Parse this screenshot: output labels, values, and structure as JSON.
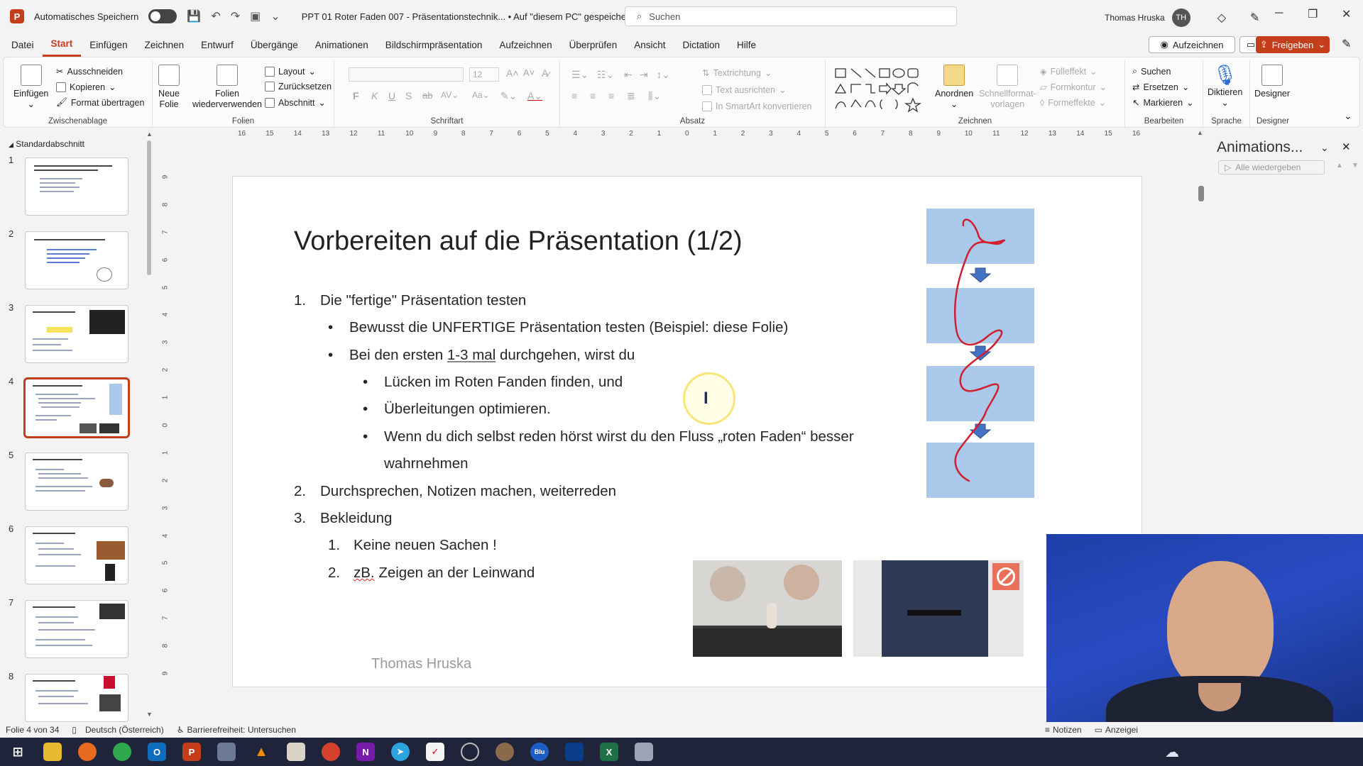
{
  "window": {
    "autosave_label": "Automatisches Speichern",
    "doc_title": "PPT 01 Roter Faden 007 - Präsentationstechnik...  •  Auf \"diesem PC\" gespeichert",
    "search_placeholder": "Suchen",
    "user_name": "Thomas Hruska",
    "user_initials": "TH"
  },
  "menu": {
    "tabs": [
      "Datei",
      "Start",
      "Einfügen",
      "Zeichnen",
      "Entwurf",
      "Übergänge",
      "Animationen",
      "Bildschirmpräsentation",
      "Aufzeichnen",
      "Überprüfen",
      "Ansicht",
      "Dictation",
      "Hilfe"
    ],
    "active": "Start",
    "record_label": "Aufzeichnen",
    "share_label": "Freigeben"
  },
  "ribbon": {
    "clipboard": {
      "paste": "Einfügen",
      "cut": "Ausschneiden",
      "copy": "Kopieren",
      "format_painter": "Format übertragen",
      "label": "Zwischenablage"
    },
    "slides": {
      "new_slide_1": "Neue",
      "new_slide_2": "Folie",
      "reuse_1": "Folien",
      "reuse_2": "wiederverwenden",
      "layout": "Layout",
      "reset": "Zurücksetzen",
      "section": "Abschnitt",
      "label": "Folien"
    },
    "font": {
      "size": "12",
      "label": "Schriftart",
      "bold": "F",
      "italic": "K",
      "underline": "U",
      "strike": "S"
    },
    "paragraph": {
      "text_direction": "Textrichtung",
      "align_text": "Text ausrichten",
      "smartart": "In SmartArt konvertieren",
      "label": "Absatz"
    },
    "drawing": {
      "arrange": "Anordnen",
      "quick_styles_1": "Schnellformat-",
      "quick_styles_2": "vorlagen",
      "fill": "Fülleffekt",
      "outline": "Formkontur",
      "effects": "Formeffekte",
      "label": "Zeichnen"
    },
    "editing": {
      "find": "Suchen",
      "replace": "Ersetzen",
      "select": "Markieren",
      "label": "Bearbeiten"
    },
    "voice": {
      "dictate": "Diktieren",
      "label": "Sprache"
    },
    "designer": {
      "designer": "Designer",
      "label": "Designer"
    }
  },
  "thumbnails": {
    "section": "Standardabschnitt",
    "numbers": [
      "1",
      "2",
      "3",
      "4",
      "5",
      "6",
      "7",
      "8"
    ],
    "selected": 4
  },
  "ruler": {
    "horizontal": [
      "16",
      "15",
      "14",
      "13",
      "12",
      "11",
      "10",
      "9",
      "8",
      "7",
      "6",
      "5",
      "4",
      "3",
      "2",
      "1",
      "0",
      "1",
      "2",
      "3",
      "4",
      "5",
      "6",
      "7",
      "8",
      "9",
      "10",
      "11",
      "12",
      "13",
      "14",
      "15",
      "16"
    ],
    "vertical": [
      "9",
      "8",
      "7",
      "6",
      "5",
      "4",
      "3",
      "2",
      "1",
      "0",
      "1",
      "2",
      "3",
      "4",
      "5",
      "6",
      "7",
      "8",
      "9"
    ]
  },
  "slide": {
    "title": "Vorbereiten auf die Präsentation (1/2)",
    "items": [
      {
        "marker": "1.",
        "text": "Die \"fertige\" Präsentation testen"
      },
      {
        "marker": "•",
        "text": "Bewusst die UNFERTIGE Präsentation testen (Beispiel: diese Folie)"
      },
      {
        "marker": "•",
        "pre": "Bei den ersten ",
        "mid": "1-3 mal",
        "post": " durchgehen, wirst du"
      },
      {
        "marker": "•",
        "text": "Lücken im Roten Fanden finden, und"
      },
      {
        "marker": "•",
        "text": "Überleitungen optimieren."
      },
      {
        "marker": "•",
        "text": "Wenn du dich selbst reden hörst wirst du den Fluss „roten Faden“ besser"
      },
      {
        "marker": "",
        "text": "wahrnehmen"
      },
      {
        "marker": "2.",
        "text": "Durchsprechen, Notizen machen, weiterreden"
      },
      {
        "marker": "3.",
        "text": "Bekleidung"
      },
      {
        "marker": "1.",
        "text": "Keine neuen Sachen !"
      },
      {
        "marker": "2.",
        "pre": "zB.",
        "post": " Zeigen an der Leinwand"
      }
    ],
    "footer": "Thomas Hruska"
  },
  "animation_pane": {
    "title": "Animations...",
    "play_all": "Alle wiedergeben"
  },
  "status": {
    "slide_of": "Folie 4 von 34",
    "language": "Deutsch (Österreich)",
    "accessibility": "Barrierefreiheit: Untersuchen",
    "notes": "Notizen",
    "display": "Anzeigei"
  },
  "colors": {
    "accent": "#c43e1c",
    "panel_blue": "#a9c8ea",
    "thread_red": "#d21f2d",
    "arrow_blue": "#4472c4"
  }
}
